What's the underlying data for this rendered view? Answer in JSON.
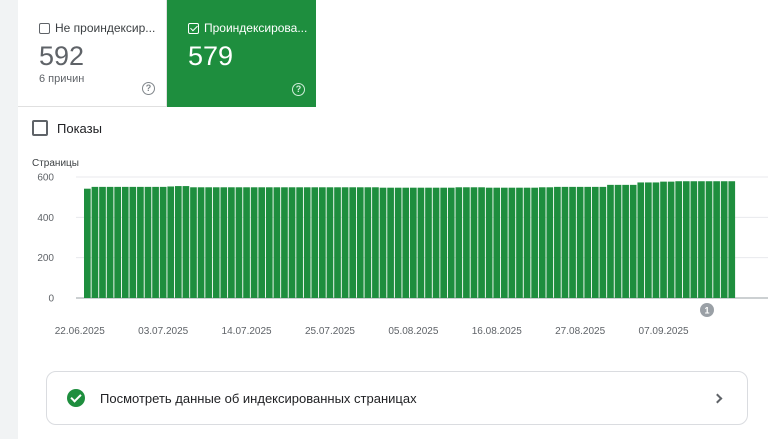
{
  "tabs": [
    {
      "label": "Не проиндексир...",
      "value": "592",
      "sub": "6 причин",
      "checked": false
    },
    {
      "label": "Проиндексирова...",
      "value": "579",
      "sub": "",
      "checked": true
    }
  ],
  "impressions_label": "Показы",
  "help_glyph": "?",
  "annotation_marker": "1",
  "cta_text": "Посмотреть данные об индексированных страницах",
  "colors": {
    "bar": "#1e8e3e",
    "accent": "#1e8e3e"
  },
  "chart_data": {
    "type": "bar",
    "ylabel": "Страницы",
    "ylim": [
      0,
      600
    ],
    "yticks": [
      0,
      200,
      400,
      600
    ],
    "xtick_labels": [
      "22.06.2025",
      "03.07.2025",
      "14.07.2025",
      "25.07.2025",
      "05.08.2025",
      "16.08.2025",
      "27.08.2025",
      "07.09.2025"
    ],
    "x_start": "22.06.2025",
    "x_end": "16.09.2025",
    "grid": true,
    "values": [
      542,
      551,
      551,
      551,
      551,
      551,
      551,
      551,
      551,
      551,
      551,
      553,
      555,
      555,
      549,
      549,
      549,
      549,
      549,
      549,
      549,
      549,
      549,
      549,
      549,
      549,
      549,
      549,
      549,
      549,
      549,
      549,
      549,
      549,
      549,
      549,
      549,
      549,
      549,
      547,
      547,
      547,
      547,
      547,
      547,
      547,
      547,
      547,
      547,
      549,
      549,
      549,
      549,
      547,
      547,
      547,
      547,
      547,
      547,
      547,
      549,
      549,
      551,
      551,
      551,
      551,
      551,
      551,
      551,
      561,
      561,
      561,
      561,
      573,
      573,
      573,
      577,
      577,
      579,
      579,
      579,
      579,
      579,
      579,
      579,
      579
    ],
    "annotations": [
      {
        "date": "12.09.2025",
        "label": "1"
      }
    ]
  }
}
